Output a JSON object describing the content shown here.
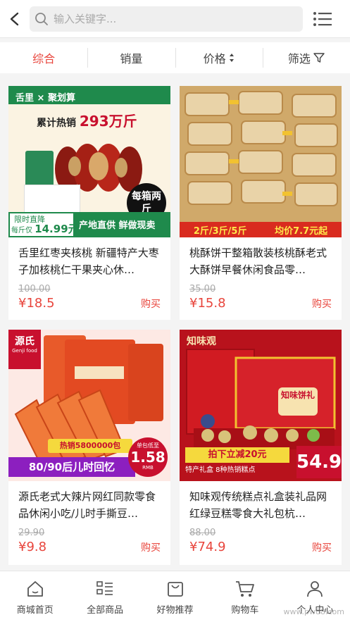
{
  "search": {
    "placeholder": "输入关键字..."
  },
  "sort_tabs": [
    {
      "label": "综合"
    },
    {
      "label": "销量"
    },
    {
      "label": "价格"
    },
    {
      "label": "筛选"
    }
  ],
  "products": [
    {
      "title": "舌里红枣夹核桃 新疆特产大枣子加核桃仁干果夹心休…",
      "original_price": "100.00",
      "price": "¥18.5",
      "buy": "购买",
      "banner": {
        "brand": "舌里",
        "partner": "聚划算",
        "headline": "累计热销",
        "sales": "293万斤",
        "badge": "每箱两斤",
        "promo": "限时直降",
        "unit_price_label": "每斤仅",
        "unit_price": "14.99元",
        "tagline": "产地直供 鲜做现卖"
      }
    },
    {
      "title": "桃酥饼干整箱散装核桃酥老式大酥饼早餐休闲食品零…",
      "original_price": "35.00",
      "price": "¥15.8",
      "buy": "购买",
      "banner": {
        "weights": "2斤/3斤/5斤",
        "avg": "均价7.7元起"
      }
    },
    {
      "title": "源氏老式大辣片网红同款零食品休闲小吃/儿时手撕豆…",
      "original_price": "29.90",
      "price": "¥9.8",
      "buy": "购买",
      "banner": {
        "brand": "源氏",
        "brand_en": "Genji food",
        "pack": "源氏大辣片",
        "hot": "热销5800000包",
        "nostalgia": "80/90后儿时回忆",
        "unit_label": "单包低至",
        "unit_price": "1.58",
        "unit": "RMB"
      }
    },
    {
      "title": "知味观传统糕点礼盒装礼品网红绿豆糕零食大礼包杭…",
      "original_price": "88.00",
      "price": "¥74.9",
      "buy": "购买",
      "banner": {
        "brand": "知味观",
        "box": "知味饼礼",
        "discount": "拍下立减20元",
        "gift": "特产礼盒 8种热销糕点",
        "final": "54.9"
      }
    }
  ],
  "bottom_nav": [
    {
      "label": "商城首页",
      "icon": "home-icon"
    },
    {
      "label": "全部商品",
      "icon": "list-icon"
    },
    {
      "label": "好物推荐",
      "icon": "bag-icon"
    },
    {
      "label": "购物车",
      "icon": "cart-icon"
    },
    {
      "label": "个人中心",
      "icon": "user-icon"
    }
  ],
  "watermark": "www.pw88.com",
  "colors": {
    "accent": "#e8453c",
    "brand_green": "#1f8a4c",
    "brand_red": "#c8102e"
  }
}
